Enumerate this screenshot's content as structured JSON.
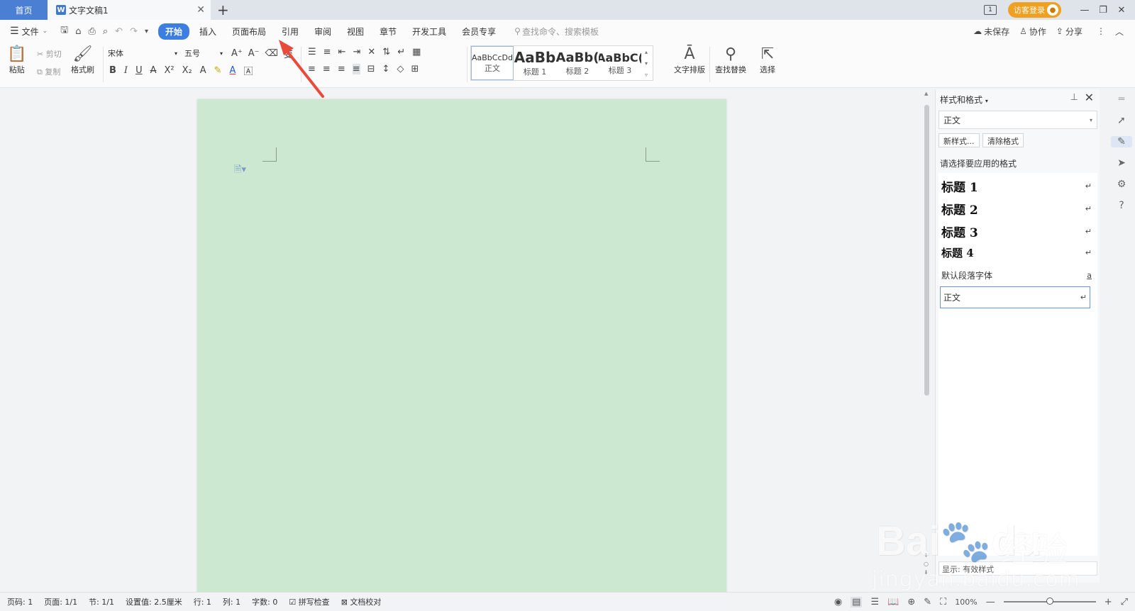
{
  "titlebar": {
    "home_tab": "首页",
    "doc_tab": "文字文稿1",
    "doc_icon": "W",
    "close": "✕",
    "add": "+",
    "layout_icon": "1",
    "visitor_login": "访客登录",
    "win_min": "—",
    "win_restore": "❐",
    "win_close": "✕"
  },
  "menubar": {
    "file": "文件",
    "tabs": [
      "开始",
      "插入",
      "页面布局",
      "引用",
      "审阅",
      "视图",
      "章节",
      "开发工具",
      "会员专享"
    ],
    "search_placeholder": "查找命令、搜索模板",
    "unsaved": "未保存",
    "collaborate": "协作",
    "share": "分享"
  },
  "ribbon": {
    "paste": "粘贴",
    "cut": "剪切",
    "copy": "复制",
    "format_painter": "格式刷",
    "font_name": "宋体",
    "font_size": "五号",
    "styles": [
      {
        "sample": "AaBbCcDd",
        "label": "正文"
      },
      {
        "sample": "AaBb",
        "label": "标题 1"
      },
      {
        "sample": "AaBb(",
        "label": "标题 2"
      },
      {
        "sample": "AaBbC(",
        "label": "标题 3"
      }
    ],
    "text_layout": "文字排版",
    "find_replace": "查找替换",
    "select": "选择"
  },
  "style_pane": {
    "title": "样式和格式",
    "current_style": "正文",
    "new_style": "新样式...",
    "clear_format": "清除格式",
    "prompt": "请选择要应用的格式",
    "items": [
      {
        "name": "标题  1",
        "mark": "↵"
      },
      {
        "name": "标题  2",
        "mark": "↵"
      },
      {
        "name": "标题  3",
        "mark": "↵"
      },
      {
        "name": "标题  4",
        "mark": "↵"
      },
      {
        "name": "默认段落字体",
        "mark": "a"
      },
      {
        "name": "正文",
        "mark": "↵"
      }
    ],
    "footer": "显示: 有效样式"
  },
  "statusbar": {
    "page_num": "页码: 1",
    "pages": "页面: 1/1",
    "section": "节: 1/1",
    "setting": "设置值: 2.5厘米",
    "row": "行: 1",
    "col": "列: 1",
    "words": "字数: 0",
    "spell_check": "拼写检查",
    "doc_proof": "文档校对",
    "zoom": "100%",
    "zoom_level": 0.5
  },
  "watermark": {
    "brand": "Bai",
    "brand2": "du",
    "cn": "经验",
    "url": "jingyan.baidu.com"
  },
  "colors": {
    "accent": "#3d7fe0",
    "page_bg": "#cde8d1",
    "arrow": "#e84a3c",
    "visitor": "#f0a020"
  }
}
